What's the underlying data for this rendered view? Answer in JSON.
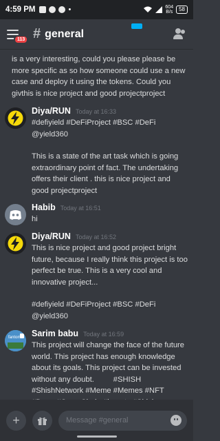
{
  "status": {
    "time": "4:59 PM",
    "speed_top": "604",
    "speed_bottom": "B/s",
    "battery": "58"
  },
  "header": {
    "hash": "#",
    "channel": "general",
    "badge": "113"
  },
  "messages": {
    "continued_text": "is a very interesting, could you please please be more specific as so how someone could use a new case and deploy it using the tokens. Could you givthis is nice project and good projectproject",
    "m1": {
      "author": "Diya/RUN",
      "timestamp": "Today at 16:33",
      "line1": "#defiyield #DeFiProject #BSC #DeFi @yield360",
      "line2": "This is a state of the art task which is going extraordinary point of fact. The undertaking offers their client . this is nice project and good projectproject"
    },
    "m2": {
      "author": "Habib",
      "timestamp": "Today at 16:51",
      "text": "hi"
    },
    "m3": {
      "author": "Diya/RUN",
      "timestamp": "Today at 16:52",
      "line1": "This is nice project and good project bright future, because I really think this project is too perfect be true. This is a very cool and innovative project...",
      "line2": "#defiyield #DeFiProject #BSC #DeFi @yield360"
    },
    "m4": {
      "author": "Sarim babu",
      "timestamp": "Today at 16:59",
      "text": "This project will change the face of the future world. This project has enough knowledge about its goals. This project can be invested without any doubt.         #SHISH #ShishNetwork #Meme #Memes #NFT #Dapp #CrossChain #bounty #Shisha #ToTheJupiter #ToTheJup #Jupiter $SHISH $Shisha $ShishNetwork #ShishArt",
      "avatar_text": "fantom"
    }
  },
  "composer": {
    "add": "+",
    "placeholder": "Message #general"
  },
  "colors": {
    "background": "#36393f",
    "accent": "#5865f2",
    "badge": "#ed4245"
  }
}
